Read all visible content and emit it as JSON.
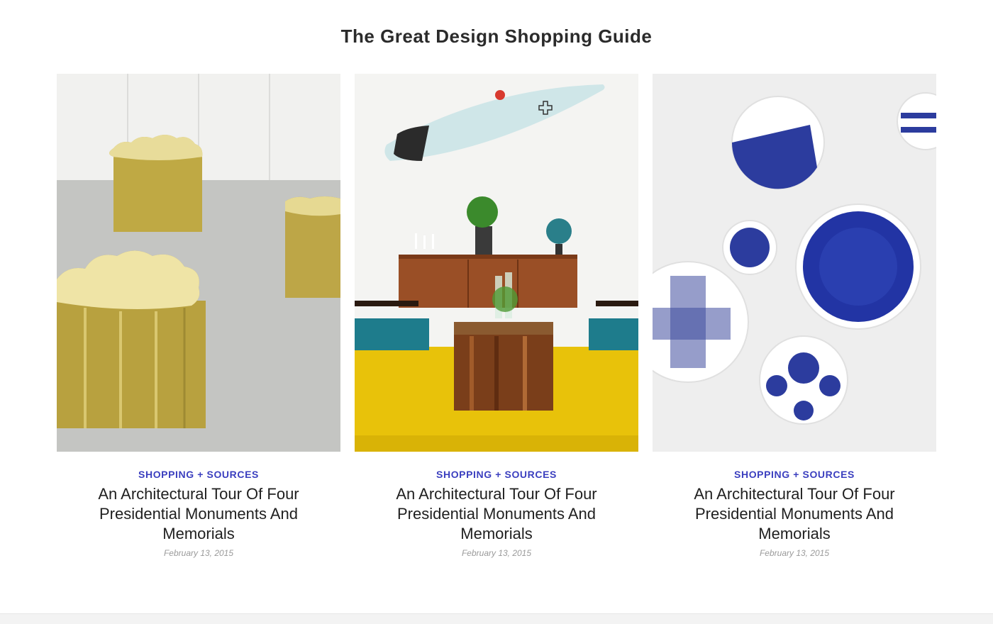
{
  "page": {
    "title": "The Great Design Shopping Guide"
  },
  "cards": [
    {
      "image": "brass-cloud-tables-photo",
      "category": "SHOPPING + SOURCES",
      "title": "An Architectural Tour Of Four Presidential Monuments And Memorials",
      "date": "February 13, 2015"
    },
    {
      "image": "surfboard-living-room-photo",
      "category": "SHOPPING + SOURCES",
      "title": "An Architectural Tour Of Four Presidential Monuments And Memorials",
      "date": "February 13, 2015"
    },
    {
      "image": "blue-plates-wall-photo",
      "category": "SHOPPING + SOURCES",
      "title": "An Architectural Tour Of Four Presidential Monuments And Memorials",
      "date": "February 13, 2015"
    }
  ],
  "colors": {
    "category": "#3b3fbf",
    "title": "#1f1f1f",
    "date": "#9a9a9a",
    "heading": "#2b2b2b"
  }
}
